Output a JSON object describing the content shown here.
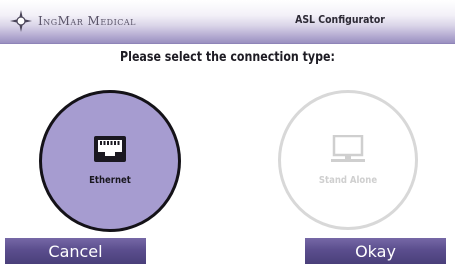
{
  "header": {
    "brand": "IngMar Medical",
    "title": "ASL Configurator",
    "logo_icon": "compass-star-icon"
  },
  "prompt": "Please select the connection type:",
  "options": [
    {
      "label": "Ethernet",
      "icon": "ethernet-port-icon",
      "selected": true
    },
    {
      "label": "Stand Alone",
      "icon": "monitor-icon",
      "selected": false
    }
  ],
  "buttons": {
    "cancel_label": "Cancel",
    "okay_label": "Okay"
  },
  "colors": {
    "accent": "#a69cd0",
    "button": "#5b4e8e",
    "header_gradient_end": "#9a90c0",
    "disabled": "#d8d8d8"
  }
}
